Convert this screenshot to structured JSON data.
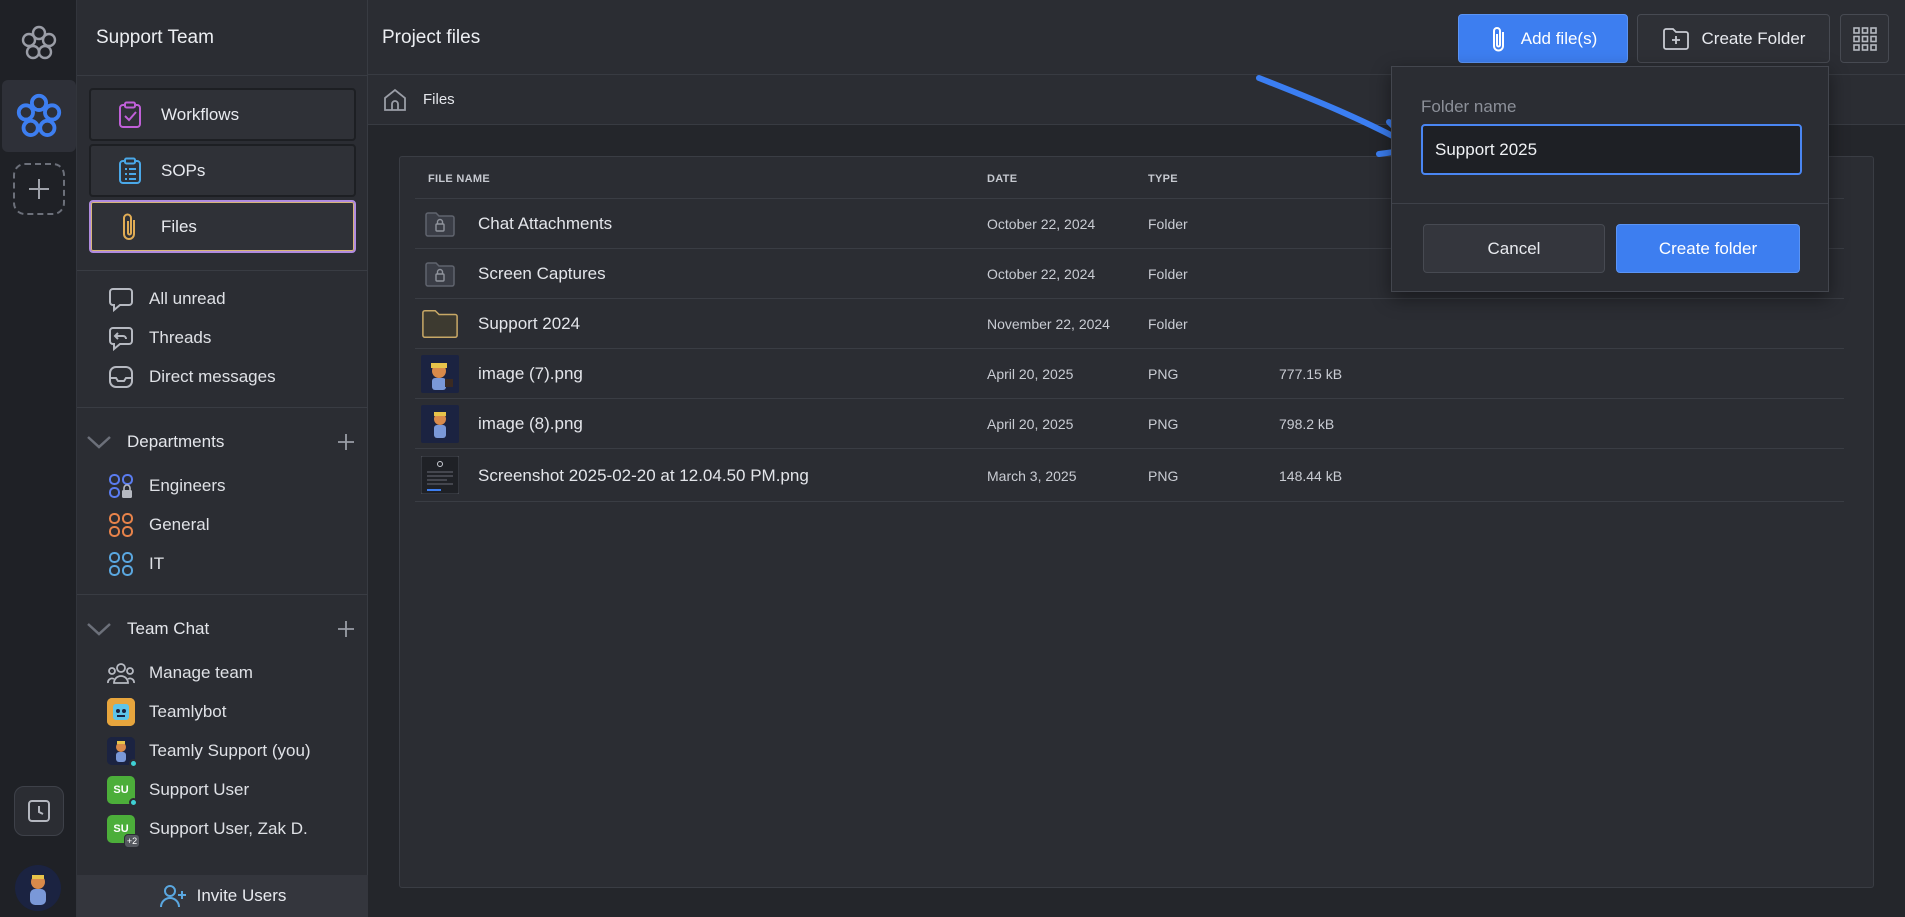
{
  "sidebar": {
    "title": "Support Team",
    "nav": [
      {
        "label": "Workflows",
        "icon": "clipboard-check-icon"
      },
      {
        "label": "SOPs",
        "icon": "clipboard-list-icon"
      },
      {
        "label": "Files",
        "icon": "paperclip-icon"
      }
    ],
    "inbox": [
      {
        "label": "All unread",
        "icon": "chat-bubble-icon"
      },
      {
        "label": "Threads",
        "icon": "threads-icon"
      },
      {
        "label": "Direct messages",
        "icon": "inbox-icon"
      }
    ],
    "departments": {
      "label": "Departments",
      "items": [
        {
          "label": "Engineers",
          "color": "#5a7cf0"
        },
        {
          "label": "General",
          "color": "#e8834a"
        },
        {
          "label": "IT",
          "color": "#5aa7e0"
        }
      ]
    },
    "team_chat": {
      "label": "Team Chat",
      "items": [
        {
          "label": "Manage team"
        },
        {
          "label": "Teamlybot"
        },
        {
          "label": "Teamly Support (you)"
        },
        {
          "label": "Support User",
          "initials": "SU"
        },
        {
          "label": "Support User, Zak D.",
          "initials": "SU",
          "badge": "+2"
        }
      ]
    },
    "invite_label": "Invite Users"
  },
  "header": {
    "title": "Project files",
    "add_files_label": "Add file(s)",
    "create_folder_label": "Create Folder"
  },
  "breadcrumb": {
    "label": "Files"
  },
  "table": {
    "headers": {
      "name": "FILE NAME",
      "date": "DATE",
      "type": "TYPE"
    },
    "rows": [
      {
        "name": "Chat Attachments",
        "date": "October 22, 2024",
        "type": "Folder",
        "size": "",
        "thumb": "locked-folder-icon"
      },
      {
        "name": "Screen Captures",
        "date": "October 22, 2024",
        "type": "Folder",
        "size": "",
        "thumb": "locked-folder-icon"
      },
      {
        "name": "Support 2024",
        "date": "November 22, 2024",
        "type": "Folder",
        "size": "",
        "thumb": "folder-icon"
      },
      {
        "name": "image (7).png",
        "date": "April 20, 2025",
        "type": "PNG",
        "size": "777.15 kB",
        "thumb": "image-thumb"
      },
      {
        "name": "image (8).png",
        "date": "April 20, 2025",
        "type": "PNG",
        "size": "798.2 kB",
        "thumb": "image-thumb"
      },
      {
        "name": "Screenshot 2025-02-20 at 12.04.50 PM.png",
        "date": "March 3, 2025",
        "type": "PNG",
        "size": "148.44 kB",
        "thumb": "screenshot-thumb"
      }
    ]
  },
  "popover": {
    "label": "Folder name",
    "value": "Support 2025",
    "cancel_label": "Cancel",
    "create_label": "Create folder"
  },
  "colors": {
    "accent": "#3d7ef0",
    "active_border": "#b08be0"
  }
}
